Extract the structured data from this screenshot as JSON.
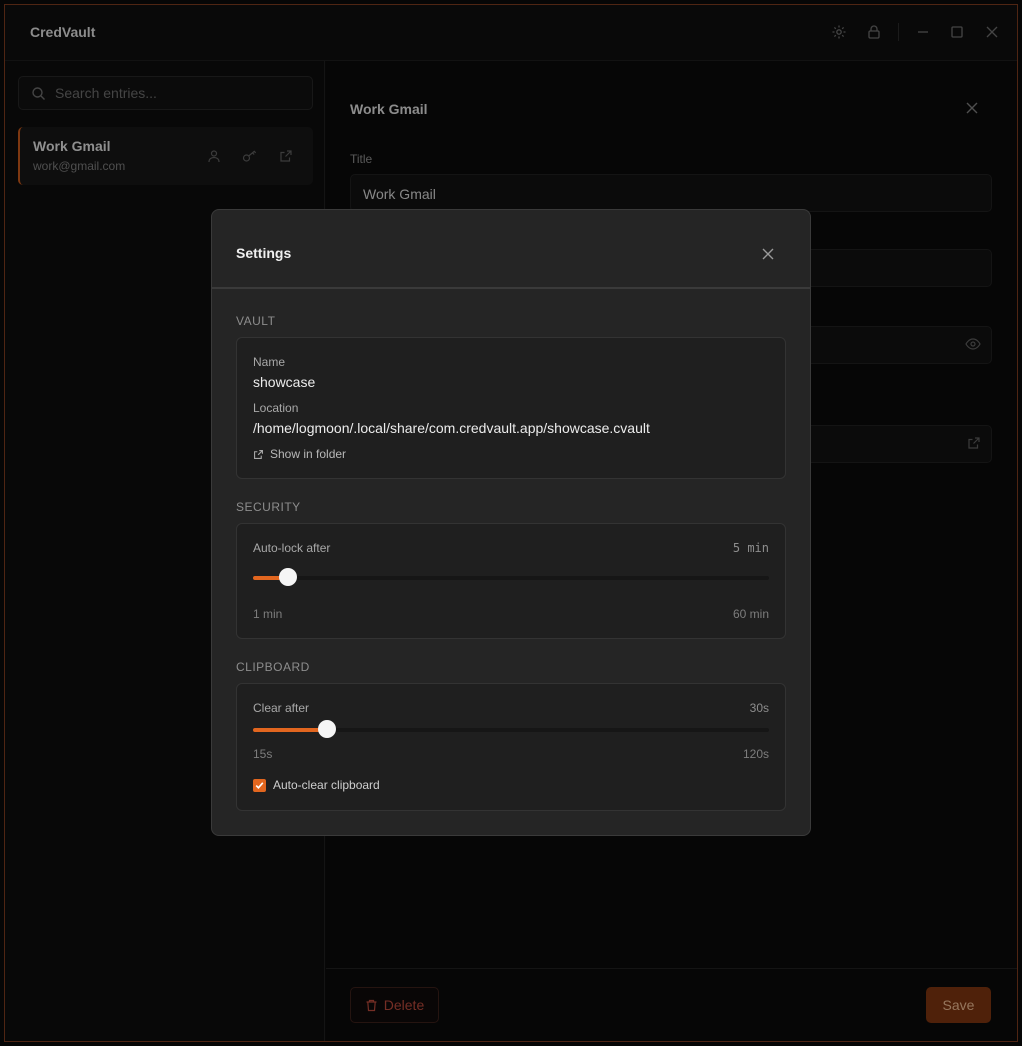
{
  "app": {
    "title": "CredVault"
  },
  "sidebar": {
    "search": {
      "placeholder": "Search entries..."
    },
    "entries": [
      {
        "title": "Work Gmail",
        "subtitle": "work@gmail.com"
      }
    ]
  },
  "detail": {
    "title": "Work Gmail",
    "fields": [
      {
        "label": "Title",
        "value": "Work Gmail"
      }
    ],
    "delete_label": "Delete",
    "save_label": "Save"
  },
  "settings": {
    "title": "Settings",
    "vault": {
      "section_label": "VAULT",
      "name_label": "Name",
      "name": "showcase",
      "location_label": "Location",
      "location": "/home/logmoon/.local/share/com.credvault.app/showcase.cvault",
      "show_in_folder": "Show in folder"
    },
    "security": {
      "section_label": "SECURITY",
      "autolock_label": "Auto-lock after",
      "autolock_value": "5 min",
      "autolock_minutes": 5,
      "min_label": "1 min",
      "max_label": "60 min",
      "min": 1,
      "max": 60
    },
    "clipboard": {
      "section_label": "CLIPBOARD",
      "clear_label": "Clear after",
      "clear_value": "30s",
      "clear_seconds": 30,
      "min_label": "15s",
      "max_label": "120s",
      "min": 15,
      "max": 120,
      "autoclear_label": "Auto-clear clipboard",
      "autoclear_checked": true
    }
  },
  "colors": {
    "accent": "#e2661f",
    "danger": "#b4473a",
    "background": "#0a0a0a",
    "modal": "#252525"
  }
}
